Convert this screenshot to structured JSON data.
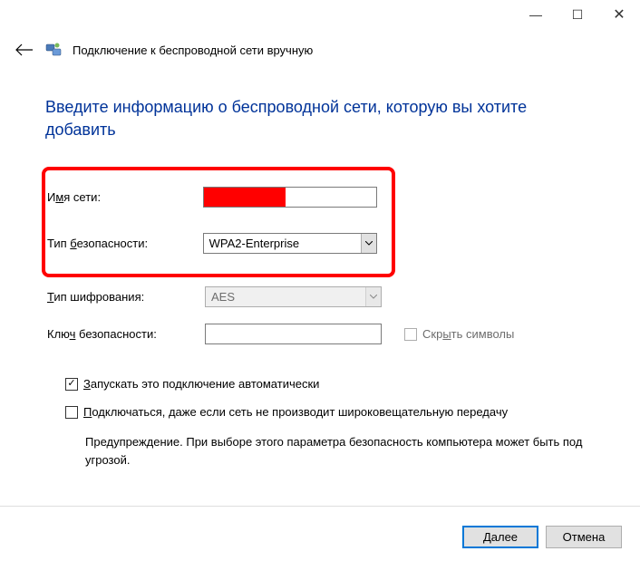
{
  "titlebar": {
    "minimize": "—",
    "maximize": "☐",
    "close": "✕"
  },
  "header": {
    "title": "Подключение к беспроводной сети вручную"
  },
  "page": {
    "heading": "Введите информацию о беспроводной сети, которую вы хотите добавить"
  },
  "form": {
    "network_name": {
      "label_pre": "И",
      "label_u": "м",
      "label_post": "я сети:",
      "value": ""
    },
    "security_type": {
      "label_pre": "Тип ",
      "label_u": "б",
      "label_post": "езопасности:",
      "value": "WPA2-Enterprise"
    },
    "encryption_type": {
      "label_pre": "",
      "label_u": "Т",
      "label_post": "ип шифрования:",
      "value": "AES"
    },
    "security_key": {
      "label_pre": "Клю",
      "label_u": "ч",
      "label_post": " безопасности:",
      "value": ""
    },
    "hide_chars": {
      "label_pre": "Скр",
      "label_u": "ы",
      "label_post": "ть символы",
      "checked": false,
      "enabled": false
    },
    "auto_connect": {
      "label_pre": "",
      "label_u": "З",
      "label_post": "апускать это подключение автоматически",
      "checked": true
    },
    "connect_hidden": {
      "label_pre": "",
      "label_u": "П",
      "label_post": "одключаться, даже если сеть не производит широковещательную передачу",
      "checked": false
    },
    "warning": "Предупреждение. При выборе этого параметра безопасность компьютера может быть под угрозой."
  },
  "footer": {
    "next": "Далее",
    "cancel": "Отмена"
  }
}
